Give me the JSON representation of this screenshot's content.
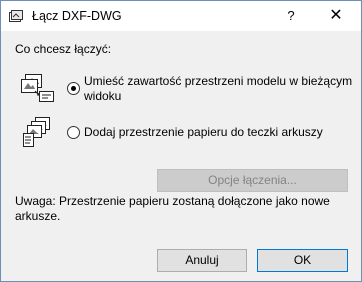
{
  "window": {
    "title": "Łącz DXF-DWG",
    "help_label": "?",
    "close_label": "✕"
  },
  "prompt": "Co chcesz łączyć:",
  "options": [
    {
      "label_line1": "Umieść zawartość przestrzeni modelu w bieżącym",
      "label_line2": "widoku",
      "selected": true
    },
    {
      "label_line1": "Dodaj przestrzenie papieru do teczki arkuszy",
      "selected": false
    }
  ],
  "buttons": {
    "options": "Opcje łączenia...",
    "cancel": "Anuluj",
    "ok": "OK"
  },
  "note": "Uwaga: Przestrzenie papieru zostaną dołączone jako nowe arkusze.",
  "colors": {
    "border": "#6e8fb3",
    "default_button_border": "#0078d7",
    "dialog_bg": "#f0f0f0"
  }
}
